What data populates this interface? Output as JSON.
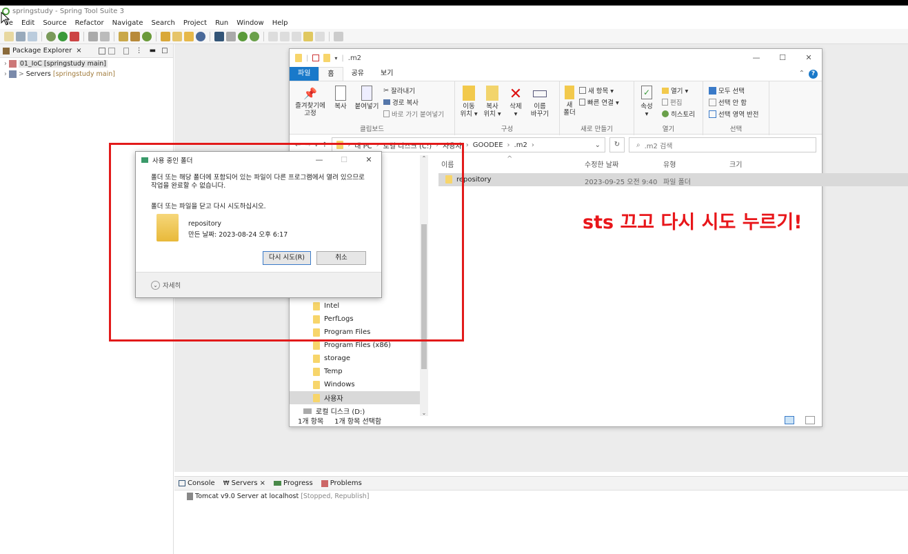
{
  "eclipse": {
    "title": "springstudy - Spring Tool Suite 3",
    "menu": [
      "File",
      "Edit",
      "Source",
      "Refactor",
      "Navigate",
      "Search",
      "Project",
      "Run",
      "Window",
      "Help"
    ],
    "menu_first_visible": "le",
    "package_explorer": {
      "tab_label": "Package Explorer",
      "items": [
        {
          "label": "01_IoC [springstudy main]"
        },
        {
          "label": "Servers",
          "suffix": "[springstudy main]"
        }
      ]
    },
    "bottom_tabs": [
      "Console",
      "Servers",
      "Progress",
      "Problems"
    ],
    "servers": [
      {
        "label": "Tomcat v9.0 Server at localhost",
        "state": "[Stopped, Republish]"
      }
    ]
  },
  "explorer": {
    "title": ".m2",
    "tabs": [
      "파일",
      "홈",
      "공유",
      "보기"
    ],
    "ribbon": {
      "clipboard": {
        "name": "클립보드",
        "pin": "즐겨찾기에\n고정",
        "copy": "복사",
        "paste": "붙여넣기",
        "cut": "잘라내기",
        "copy_path": "경로 복사",
        "paste_shortcut": "바로 가기 붙여넣기"
      },
      "organize": {
        "name": "구성",
        "move": "이동\n위치 ▾",
        "copyto": "복사\n위치 ▾",
        "delete": "삭제\n▾",
        "rename": "이름\n바꾸기"
      },
      "new": {
        "name": "새로 만들기",
        "folder": "새\n폴더",
        "new_item": "새 항목 ▾",
        "easy_access": "빠른 연결 ▾"
      },
      "open": {
        "name": "열기",
        "properties": "속성\n▾",
        "open": "열기 ▾",
        "edit": "편집",
        "history": "히스토리"
      },
      "select": {
        "name": "선택",
        "all": "모두 선택",
        "none": "선택 안 함",
        "invert": "선택 영역 반전"
      }
    },
    "address": [
      "내 PC",
      "로컬 디스크 (C:)",
      "사용자",
      "GOODEE",
      ".m2"
    ],
    "search_placeholder": ".m2 검색",
    "nav_items": [
      "Intel",
      "PerfLogs",
      "Program Files",
      "Program Files (x86)",
      "storage",
      "Temp",
      "Windows",
      "사용자",
      "로컬 디스크 (D:)"
    ],
    "columns": [
      "이름",
      "수정한 날짜",
      "유형",
      "크기"
    ],
    "files": [
      {
        "name": "repository",
        "date": "2023-09-25 오전 9:40",
        "type": "파일 폴더"
      }
    ],
    "status": {
      "count": "1개 항목",
      "selected": "1개 항목 선택함"
    }
  },
  "dialog": {
    "title": "사용 중인 폴더",
    "message1": "폴더 또는 해당 폴더에 포함되어 있는 파일이 다른 프로그램에서 열려 있으므로 작업을 완료할 수 없습니다.",
    "message2": "폴더 또는 파일을 닫고 다시 시도하십시오.",
    "item_name": "repository",
    "item_created": "만든 날짜: 2023-08-24 오후 6:17",
    "retry": "다시 시도(R)",
    "cancel": "취소",
    "details": "자세히"
  },
  "annotation": {
    "text": "sts 끄고 다시 시도 누르기!",
    "color": "#e8161a"
  }
}
